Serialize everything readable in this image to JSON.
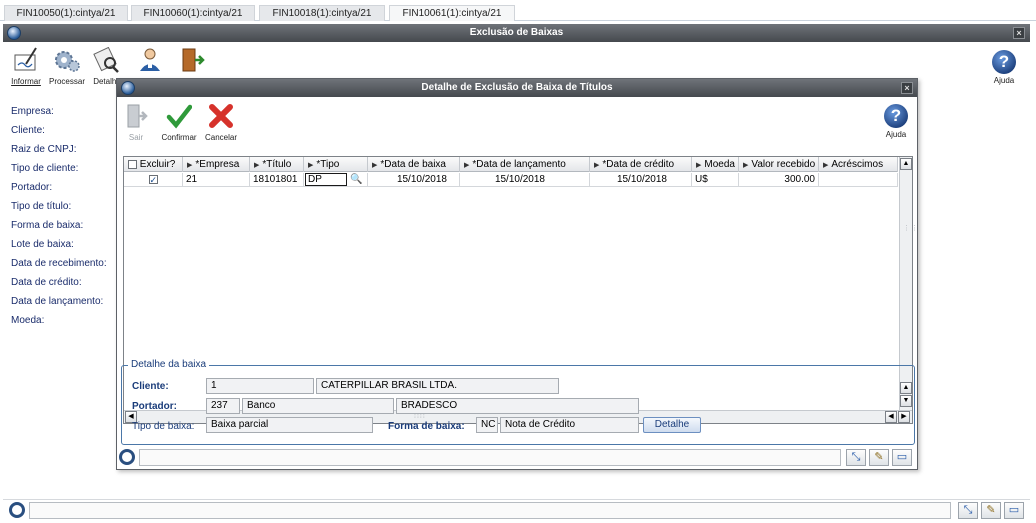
{
  "tabs": [
    {
      "label": "FIN10050(1):cintya/21",
      "active": false
    },
    {
      "label": "FIN10060(1):cintya/21",
      "active": false
    },
    {
      "label": "FIN10018(1):cintya/21",
      "active": false
    },
    {
      "label": "FIN10061(1):cintya/21",
      "active": true
    }
  ],
  "main_window": {
    "title": "Exclusão de Baixas",
    "toolbar": {
      "informar": "Informar",
      "processar": "Processar",
      "detalhe": "Detalhe",
      "ajuda": "Ajuda"
    },
    "fields": [
      "Empresa:",
      "Cliente:",
      "Raiz de CNPJ:",
      "Tipo de cliente:",
      "Portador:",
      "Tipo de título:",
      "Forma de baixa:",
      "Lote de baixa:",
      "Data de recebimento:",
      "Data de crédito:",
      "Data de lançamento:",
      "Moeda:"
    ]
  },
  "dialog": {
    "title": "Detalhe de Exclusão de Baixa de Títulos",
    "toolbar": {
      "sair": "Sair",
      "confirmar": "Confirmar",
      "cancelar": "Cancelar",
      "ajuda": "Ajuda"
    },
    "grid": {
      "columns": [
        {
          "label": "Excluir?"
        },
        {
          "label": "*Empresa"
        },
        {
          "label": "*Título"
        },
        {
          "label": "*Tipo"
        },
        {
          "label": "*Data de baixa"
        },
        {
          "label": "*Data de lançamento"
        },
        {
          "label": "*Data de crédito"
        },
        {
          "label": "Moeda"
        },
        {
          "label": "Valor recebido"
        },
        {
          "label": "Acréscimos"
        }
      ],
      "rows": [
        {
          "excluir": true,
          "empresa": "21",
          "titulo": "18101801",
          "tipo": "DP",
          "data_baixa": "15/10/2018",
          "data_lancamento": "15/10/2018",
          "data_credito": "15/10/2018",
          "moeda": "U$",
          "valor_recebido": "300.00",
          "acrescimos": ""
        }
      ]
    },
    "detail": {
      "legend": "Detalhe da baixa",
      "cliente_label": "Cliente:",
      "cliente_code": "1",
      "cliente_extra": "",
      "cliente_name": "CATERPILLAR BRASIL LTDA.",
      "portador_label": "Portador:",
      "portador_code": "237",
      "portador_tipo": "Banco",
      "portador_name": "BRADESCO",
      "tipo_baixa_label": "Tipo de baixa:",
      "tipo_baixa_value": "Baixa parcial",
      "forma_baixa_label": "Forma de baixa:",
      "forma_baixa_code": "NC",
      "forma_baixa_value": "Nota de Crédito",
      "detalhe_button": "Detalhe"
    }
  },
  "colors": {
    "titlebar": "#45494e",
    "label_blue": "#1a3c7a",
    "accent_blue": "#2a5d9a"
  }
}
